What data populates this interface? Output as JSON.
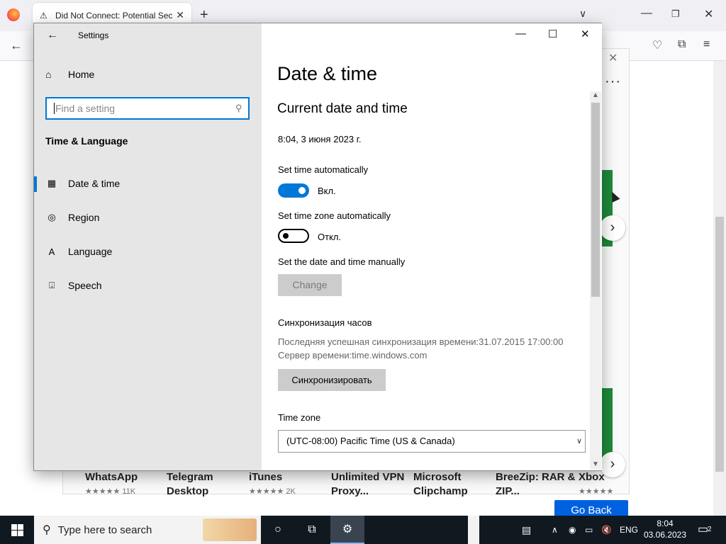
{
  "browser": {
    "tab_title": "Did Not Connect: Potential Sec",
    "store_apps": [
      {
        "name": "WhatsApp",
        "rating": "★★★★★",
        "count": "11K"
      },
      {
        "name": "Telegram Desktop",
        "rating": "",
        "count": ""
      },
      {
        "name": "iTunes",
        "rating": "★★★★★",
        "count": "2K"
      },
      {
        "name": "Unlimited VPN Proxy...",
        "rating": "",
        "count": ""
      },
      {
        "name": "Microsoft Clipchamp",
        "rating": "",
        "count": ""
      },
      {
        "name": "BreeZip: RAR & ZIP...",
        "rating": "",
        "count": ""
      },
      {
        "name": "Xbox",
        "rating": "★★★★★",
        "count": ""
      }
    ],
    "go_back_label": "Go Back"
  },
  "settings": {
    "window_title": "Settings",
    "home_label": "Home",
    "search_placeholder": "Find a setting",
    "section_title": "Time & Language",
    "nav": [
      {
        "label": "Date & time",
        "icon": "calendar-clock-icon",
        "active": true
      },
      {
        "label": "Region",
        "icon": "globe-icon",
        "active": false
      },
      {
        "label": "Language",
        "icon": "language-icon",
        "active": false
      },
      {
        "label": "Speech",
        "icon": "microphone-icon",
        "active": false
      }
    ],
    "page_title": "Date & time",
    "subheading": "Current date and time",
    "current_datetime": "8:04, 3 июня 2023 г.",
    "set_time_auto_label": "Set time automatically",
    "set_time_auto_state": "Вкл.",
    "set_tz_auto_label": "Set time zone automatically",
    "set_tz_auto_state": "Откл.",
    "manual_label": "Set the date and time manually",
    "change_button": "Change",
    "sync_title": "Синхронизация часов",
    "sync_last": "Последняя успешная синхронизация времени:31.07.2015 17:00:00",
    "sync_server": "Сервер времени:time.windows.com",
    "sync_button": "Синхронизировать",
    "timezone_label": "Time zone",
    "timezone_value": "(UTC-08:00) Pacific Time (US & Canada)"
  },
  "taskbar": {
    "search_placeholder": "Type here to search",
    "language": "ENG",
    "time": "8:04",
    "date": "03.06.2023",
    "notification_count": "2"
  },
  "colors": {
    "accent": "#0078d7",
    "taskbar": "#101820"
  }
}
